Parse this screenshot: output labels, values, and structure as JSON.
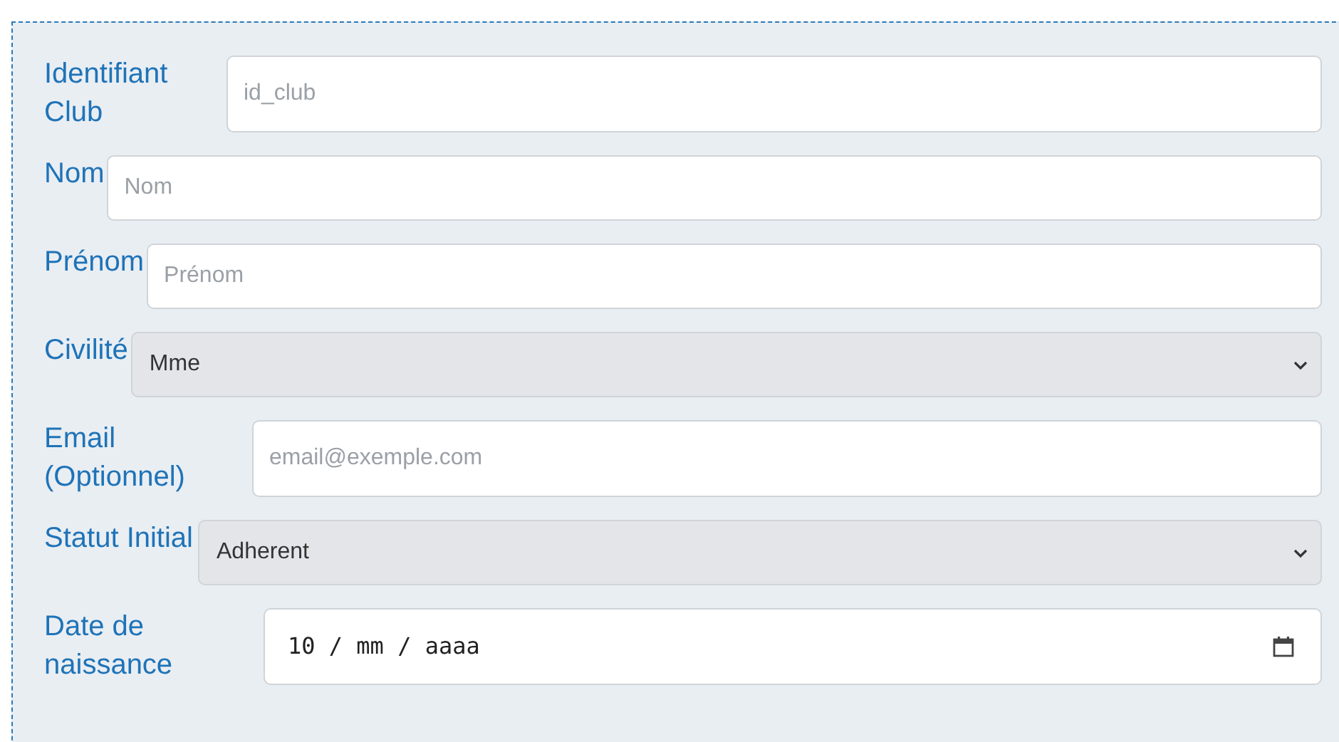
{
  "form": {
    "fields": [
      {
        "kind": "text",
        "label": "Identifiant Club",
        "placeholder": "id_club"
      },
      {
        "kind": "text",
        "label": "Nom",
        "placeholder": "Nom"
      },
      {
        "kind": "text",
        "label": "Prénom",
        "placeholder": "Prénom"
      },
      {
        "kind": "select",
        "label": "Civilité",
        "value": "Mme"
      },
      {
        "kind": "text",
        "label": "Email (Optionnel)",
        "placeholder": "email@exemple.com"
      },
      {
        "kind": "select",
        "label": "Statut Initial",
        "value": "Adherent"
      },
      {
        "kind": "date",
        "label": "Date de naissance",
        "value": "10 / mm / aaaa"
      }
    ]
  }
}
